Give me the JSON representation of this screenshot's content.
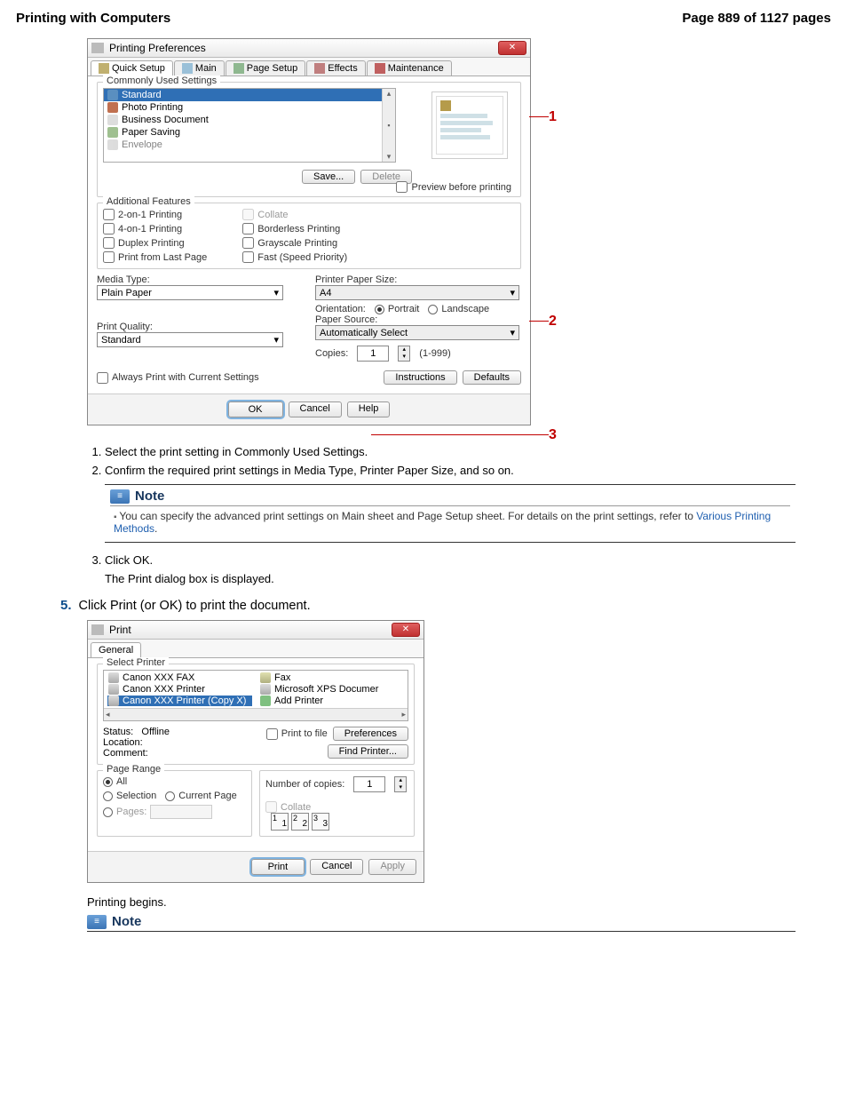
{
  "header": {
    "title_left": "Printing with Computers",
    "title_right": "Page 889 of 1127 pages"
  },
  "prefs_dialog": {
    "title": "Printing Preferences",
    "tabs": [
      "Quick Setup",
      "Main",
      "Page Setup",
      "Effects",
      "Maintenance"
    ],
    "commonly_used_label": "Commonly Used Settings",
    "settings_items": [
      "Standard",
      "Photo Printing",
      "Business Document",
      "Paper Saving",
      "Envelope"
    ],
    "save_btn": "Save...",
    "delete_btn": "Delete",
    "preview_label": "Preview before printing",
    "additional_label": "Additional Features",
    "features_left": [
      "2-on-1 Printing",
      "4-on-1 Printing",
      "Duplex Printing",
      "Print from Last Page"
    ],
    "features_right": [
      "Collate",
      "Borderless Printing",
      "Grayscale Printing",
      "Fast (Speed Priority)"
    ],
    "media_type_label": "Media Type:",
    "media_type_value": "Plain Paper",
    "paper_size_label": "Printer Paper Size:",
    "paper_size_value": "A4",
    "orientation_label": "Orientation:",
    "orientation_portrait": "Portrait",
    "orientation_landscape": "Landscape",
    "print_quality_label": "Print Quality:",
    "print_quality_value": "Standard",
    "paper_source_label": "Paper Source:",
    "paper_source_value": "Automatically Select",
    "copies_label": "Copies:",
    "copies_value": "1",
    "copies_range": "(1-999)",
    "always_label": "Always Print with Current Settings",
    "instructions_btn": "Instructions",
    "defaults_btn": "Defaults",
    "ok_btn": "OK",
    "cancel_btn": "Cancel",
    "help_btn": "Help",
    "callouts": {
      "one": "1",
      "two": "2",
      "three": "3"
    }
  },
  "steps": {
    "s1": "Select the print setting in Commonly Used Settings.",
    "s2": "Confirm the required print settings in Media Type, Printer Paper Size, and so on.",
    "note_title": "Note",
    "note_body_pre": "You can specify the advanced print settings on Main sheet and Page Setup sheet. For details on the print settings, refer to ",
    "note_link": "Various Printing Methods",
    "note_body_post": ".",
    "s3a": "Click OK.",
    "s3b": "The Print dialog box is displayed.",
    "s5_num": "5.",
    "s5_text": "Click Print (or OK) to print the document."
  },
  "print_dialog": {
    "title": "Print",
    "tab": "General",
    "select_printer_label": "Select Printer",
    "printers_left": [
      "Canon XXX FAX",
      "Canon XXX Printer",
      "Canon XXX Printer (Copy X)"
    ],
    "printers_right": [
      "Fax",
      "Microsoft XPS Documer",
      "Add Printer"
    ],
    "status_label": "Status:",
    "status_value": "Offline",
    "location_label": "Location:",
    "comment_label": "Comment:",
    "print_to_file": "Print to file",
    "preferences_btn": "Preferences",
    "find_printer_btn": "Find Printer...",
    "page_range_label": "Page Range",
    "all": "All",
    "selection": "Selection",
    "current_page": "Current Page",
    "pages": "Pages:",
    "num_copies_label": "Number of copies:",
    "num_copies_value": "1",
    "collate": "Collate",
    "print_btn": "Print",
    "cancel_btn": "Cancel",
    "apply_btn": "Apply"
  },
  "after_print": "Printing begins.",
  "note2_title": "Note"
}
